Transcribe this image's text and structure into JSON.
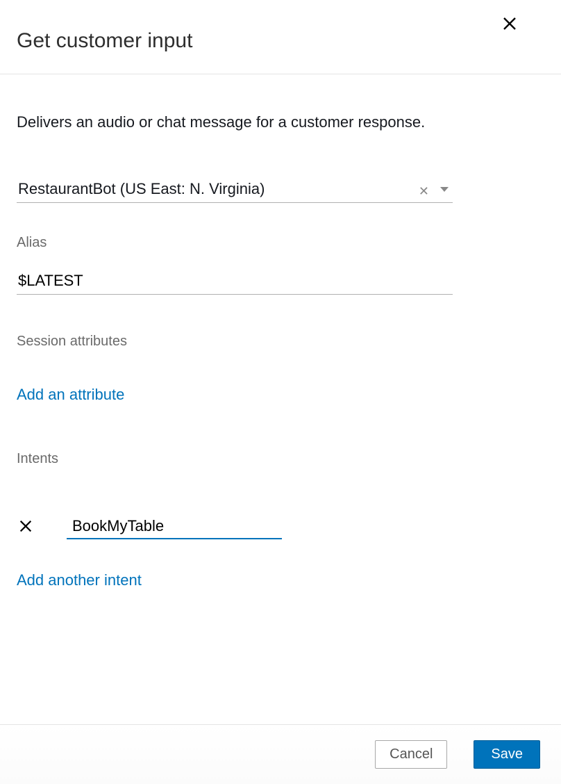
{
  "header": {
    "title": "Get customer input"
  },
  "description": "Delivers an audio or chat message for a customer response.",
  "bot_select": {
    "value": "RestaurantBot (US East: N. Virginia)"
  },
  "alias": {
    "label": "Alias",
    "value": "$LATEST"
  },
  "session_attributes": {
    "label": "Session attributes",
    "add_link": "Add an attribute"
  },
  "intents": {
    "label": "Intents",
    "items": [
      {
        "value": "BookMyTable"
      }
    ],
    "add_link": "Add another intent"
  },
  "footer": {
    "cancel": "Cancel",
    "save": "Save"
  }
}
